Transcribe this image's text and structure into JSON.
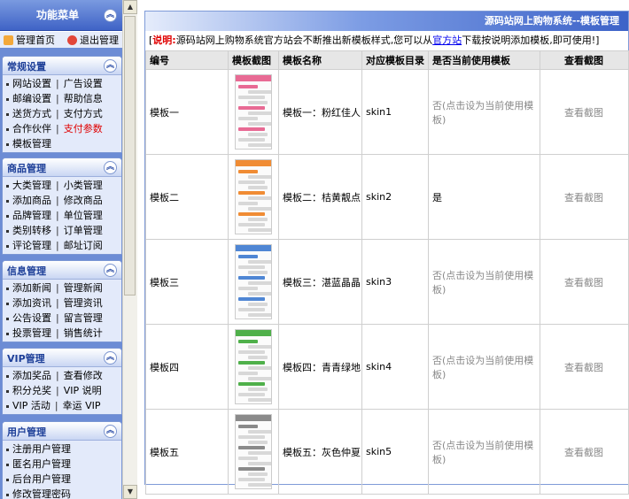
{
  "sidebar": {
    "menu_title": "功能菜单",
    "quick_links": [
      "管理首页",
      "退出管理"
    ],
    "sections": [
      {
        "title": "常规设置",
        "rows": [
          [
            "网站设置",
            "广告设置"
          ],
          [
            "邮编设置",
            "帮助信息"
          ],
          [
            "送货方式",
            "支付方式"
          ],
          [
            "合作伙伴",
            "支付参数"
          ],
          [
            "模板管理"
          ]
        ]
      },
      {
        "title": "商品管理",
        "rows": [
          [
            "大类管理",
            "小类管理"
          ],
          [
            "添加商品",
            "修改商品"
          ],
          [
            "品牌管理",
            "单位管理"
          ],
          [
            "类别转移",
            "订单管理"
          ],
          [
            "评论管理",
            "邮址订阅"
          ]
        ]
      },
      {
        "title": "信息管理",
        "rows": [
          [
            "添加新闻",
            "管理新闻"
          ],
          [
            "添加资讯",
            "管理资讯"
          ],
          [
            "公告设置",
            "留言管理"
          ],
          [
            "投票管理",
            "销售统计"
          ]
        ]
      },
      {
        "title": "VIP管理",
        "rows": [
          [
            "添加奖品",
            "查看修改"
          ],
          [
            "积分兑奖",
            "VIP 说明"
          ],
          [
            "VIP 活动",
            "幸运 VIP"
          ]
        ]
      },
      {
        "title": "用户管理",
        "rows": [
          [
            "注册用户管理"
          ],
          [
            "匿名用户管理"
          ],
          [
            "后台用户管理"
          ],
          [
            "修改管理密码"
          ]
        ]
      }
    ]
  },
  "main": {
    "title": "源码站网上购物系统--模板管理",
    "notice": {
      "label": "说明:",
      "text_before": "源码站网上购物系统官方站会不断推出新模板样式,您可以从",
      "link": "官方站",
      "text_after": "下载按说明添加模板,即可使用!"
    },
    "table": {
      "headers": [
        "编号",
        "模板截图",
        "模板名称",
        "对应模板目录",
        "是否当前使用模板",
        "查看截图"
      ],
      "rows": [
        {
          "id": "模板一",
          "name": "模板一：粉红佳人",
          "dir": "skin1",
          "status": "否(点击设为当前使用模板)",
          "view": "查看截图",
          "color": "#e86a94"
        },
        {
          "id": "模板二",
          "name": "模板二：桔黄靓点",
          "dir": "skin2",
          "status": "是",
          "view": "查看截图",
          "color": "#f08c34"
        },
        {
          "id": "模板三",
          "name": "模板三：湛蓝晶晶",
          "dir": "skin3",
          "status": "否(点击设为当前使用模板)",
          "view": "查看截图",
          "color": "#4f86d4"
        },
        {
          "id": "模板四",
          "name": "模板四：青青绿地",
          "dir": "skin4",
          "status": "否(点击设为当前使用模板)",
          "view": "查看截图",
          "color": "#4fb04a"
        },
        {
          "id": "模板五",
          "name": "模板五：灰色仲夏",
          "dir": "skin5",
          "status": "否(点击设为当前使用模板)",
          "view": "查看截图",
          "color": "#8a8a8a"
        }
      ]
    }
  },
  "colors": {
    "sidebar_bg": "#6c8cd5",
    "section_title": "#1d3f98",
    "notice_red": "#e00000",
    "link_blue": "#0000ee"
  },
  "icons": [
    "home-icon",
    "exit-icon",
    "collapse-icon",
    "scroll-up-icon",
    "scroll-down-icon"
  ]
}
